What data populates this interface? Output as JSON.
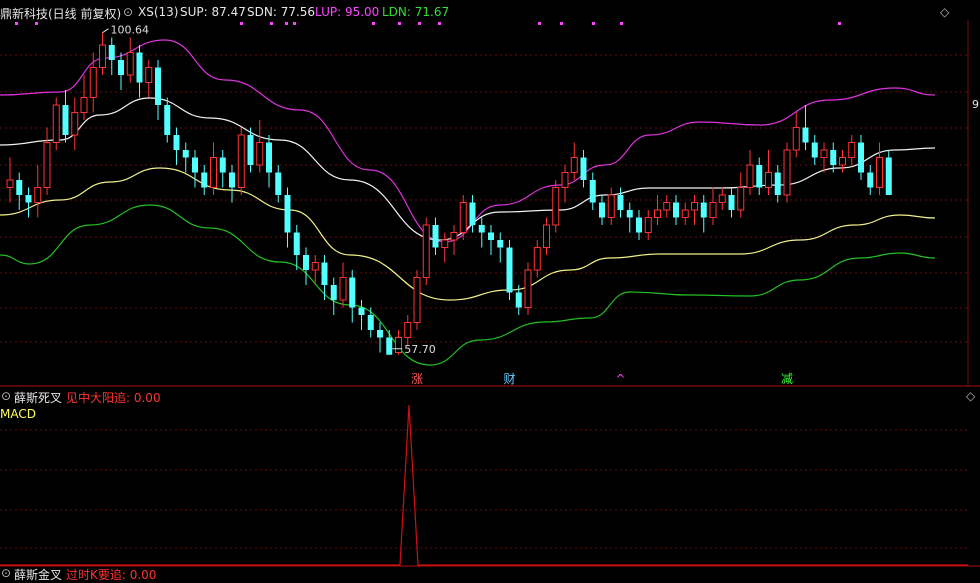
{
  "header": {
    "title": "鼎新科技(日线 前复权)",
    "indicator": "XS(13)",
    "sup": "SUP: 87.47",
    "sdn": "SDN: 77.56",
    "lup": "LUP: 95.00",
    "ldn": "LDN: 71.67"
  },
  "panel2": {
    "name": "薛斯死叉",
    "signal": "见中大阳追: 0.00",
    "sub": "MACD"
  },
  "panel3": {
    "name": "薛斯金叉",
    "signal": "过时K要追: 0.00"
  },
  "right_axis_fragment": "9",
  "colors": {
    "up": "#ff3333",
    "down": "#54ffff",
    "upper_band": "#dd33dd",
    "mid_upper": "#f2f2f2",
    "mid_lower": "#f0f08a",
    "lower_band": "#22c022",
    "grid": "#6a1010",
    "spike": "#d01010"
  },
  "chart_data": {
    "type": "candlestick",
    "price_high_label": "100.64",
    "price_low_label": "57.70",
    "signals": [
      {
        "index": 44,
        "text": "涨",
        "color": "#ff5555"
      },
      {
        "index": 54,
        "text": "财",
        "color": "#66ccff"
      },
      {
        "index": 66,
        "text": "^",
        "color": "#ff44ff"
      },
      {
        "index": 84,
        "text": "减",
        "color": "#33ff33"
      }
    ],
    "candles": [
      [
        80,
        81,
        84,
        78
      ],
      [
        81,
        79,
        82,
        77
      ],
      [
        79,
        78,
        80,
        76
      ],
      [
        78,
        80,
        83,
        76
      ],
      [
        80,
        86,
        88,
        79
      ],
      [
        86,
        91,
        92,
        85
      ],
      [
        91,
        87,
        93,
        86
      ],
      [
        87,
        90,
        92,
        85
      ],
      [
        90,
        92,
        95,
        89
      ],
      [
        92,
        96,
        98,
        90
      ],
      [
        96,
        99,
        100.64,
        95
      ],
      [
        99,
        97,
        100,
        95
      ],
      [
        97,
        95,
        98,
        93
      ],
      [
        95,
        98,
        100,
        94
      ],
      [
        98,
        94,
        99,
        92
      ],
      [
        94,
        96,
        97,
        92
      ],
      [
        96,
        91,
        97,
        89
      ],
      [
        91,
        87,
        92,
        86
      ],
      [
        87,
        85,
        88,
        83
      ],
      [
        85,
        84,
        86,
        82
      ],
      [
        84,
        82,
        85,
        80
      ],
      [
        82,
        80,
        83,
        79
      ],
      [
        80,
        84,
        86,
        79
      ],
      [
        84,
        82,
        85,
        80
      ],
      [
        82,
        80,
        83,
        78
      ],
      [
        80,
        87,
        88,
        79
      ],
      [
        87,
        83,
        88,
        82
      ],
      [
        83,
        86,
        89,
        82
      ],
      [
        86,
        82,
        87,
        80
      ],
      [
        82,
        79,
        83,
        78
      ],
      [
        79,
        74,
        80,
        72
      ],
      [
        74,
        71,
        75,
        69
      ],
      [
        71,
        69,
        72,
        67
      ],
      [
        69,
        70,
        71,
        67
      ],
      [
        70,
        67,
        71,
        65
      ],
      [
        67,
        65,
        68,
        63
      ],
      [
        65,
        68,
        70,
        64
      ],
      [
        68,
        64,
        69,
        62
      ],
      [
        64,
        63,
        65,
        61
      ],
      [
        63,
        61,
        64,
        60
      ],
      [
        61,
        60,
        62,
        58
      ],
      [
        60,
        57.7,
        61,
        57.7
      ],
      [
        58,
        60,
        61,
        57.7
      ],
      [
        60,
        62,
        63,
        59
      ],
      [
        62,
        68,
        69,
        61
      ],
      [
        68,
        75,
        76,
        67
      ],
      [
        75,
        72,
        76,
        71
      ],
      [
        72,
        73,
        74,
        70
      ],
      [
        73,
        74,
        75,
        71
      ],
      [
        74,
        78,
        79,
        73
      ],
      [
        78,
        75,
        79,
        74
      ],
      [
        75,
        74,
        76,
        72
      ],
      [
        74,
        73,
        75,
        71
      ],
      [
        73,
        72,
        74,
        70
      ],
      [
        72,
        66,
        73,
        65
      ],
      [
        66,
        64,
        67,
        63
      ],
      [
        64,
        69,
        70,
        63
      ],
      [
        69,
        72,
        73,
        68
      ],
      [
        72,
        75,
        76,
        71
      ],
      [
        75,
        80,
        81,
        74
      ],
      [
        80,
        82,
        83,
        78
      ],
      [
        82,
        84,
        86,
        81
      ],
      [
        84,
        81,
        85,
        80
      ],
      [
        81,
        78,
        82,
        77
      ],
      [
        78,
        76,
        79,
        75
      ],
      [
        76,
        79,
        80,
        75
      ],
      [
        79,
        77,
        80,
        76
      ],
      [
        77,
        76,
        78,
        74
      ],
      [
        76,
        74,
        77,
        73
      ],
      [
        74,
        76,
        77,
        73
      ],
      [
        76,
        77,
        79,
        75
      ],
      [
        77,
        78,
        79,
        76
      ],
      [
        78,
        76,
        79,
        75
      ],
      [
        76,
        77,
        78,
        75
      ],
      [
        77,
        78,
        79,
        75
      ],
      [
        78,
        76,
        79,
        74
      ],
      [
        76,
        78,
        80,
        75
      ],
      [
        78,
        79,
        80,
        77
      ],
      [
        79,
        77,
        80,
        76
      ],
      [
        77,
        80,
        82,
        76
      ],
      [
        80,
        83,
        85,
        79
      ],
      [
        83,
        80,
        84,
        79
      ],
      [
        80,
        82,
        85,
        79
      ],
      [
        82,
        79,
        83,
        78
      ],
      [
        79,
        85,
        86,
        78
      ],
      [
        85,
        88,
        90,
        84
      ],
      [
        88,
        86,
        91,
        85
      ],
      [
        86,
        84,
        87,
        83
      ],
      [
        84,
        85,
        86,
        82
      ],
      [
        85,
        83,
        86,
        82
      ],
      [
        83,
        84,
        85,
        82
      ],
      [
        84,
        86,
        87,
        83
      ],
      [
        86,
        82,
        87,
        81
      ],
      [
        82,
        80,
        83,
        79
      ],
      [
        80,
        84,
        86,
        79
      ],
      [
        84,
        79,
        85,
        79
      ]
    ]
  }
}
